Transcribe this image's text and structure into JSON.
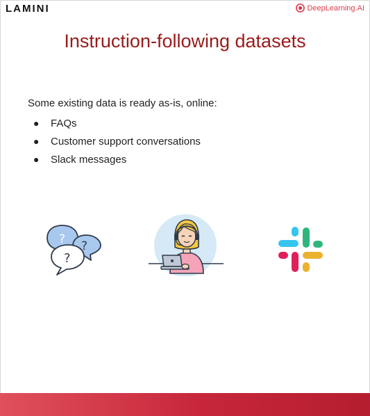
{
  "header": {
    "brand_left": "LAMINI",
    "brand_right": "DeepLearning.AI"
  },
  "slide": {
    "title": "Instruction-following datasets",
    "intro": "Some existing data is ready as-is, online:",
    "bullets": [
      "FAQs",
      "Customer support conversations",
      "Slack messages"
    ]
  },
  "icons": [
    {
      "name": "faq-speech-bubbles-icon"
    },
    {
      "name": "customer-support-agent-icon"
    },
    {
      "name": "slack-logo-icon"
    }
  ],
  "colors": {
    "title": "#9b1b1b",
    "brand_accent": "#e03a4a",
    "footer": "#c7263a",
    "slack_blue": "#36c5f0",
    "slack_green": "#2eb67d",
    "slack_yellow": "#ecb22e",
    "slack_red": "#e01e5a"
  }
}
